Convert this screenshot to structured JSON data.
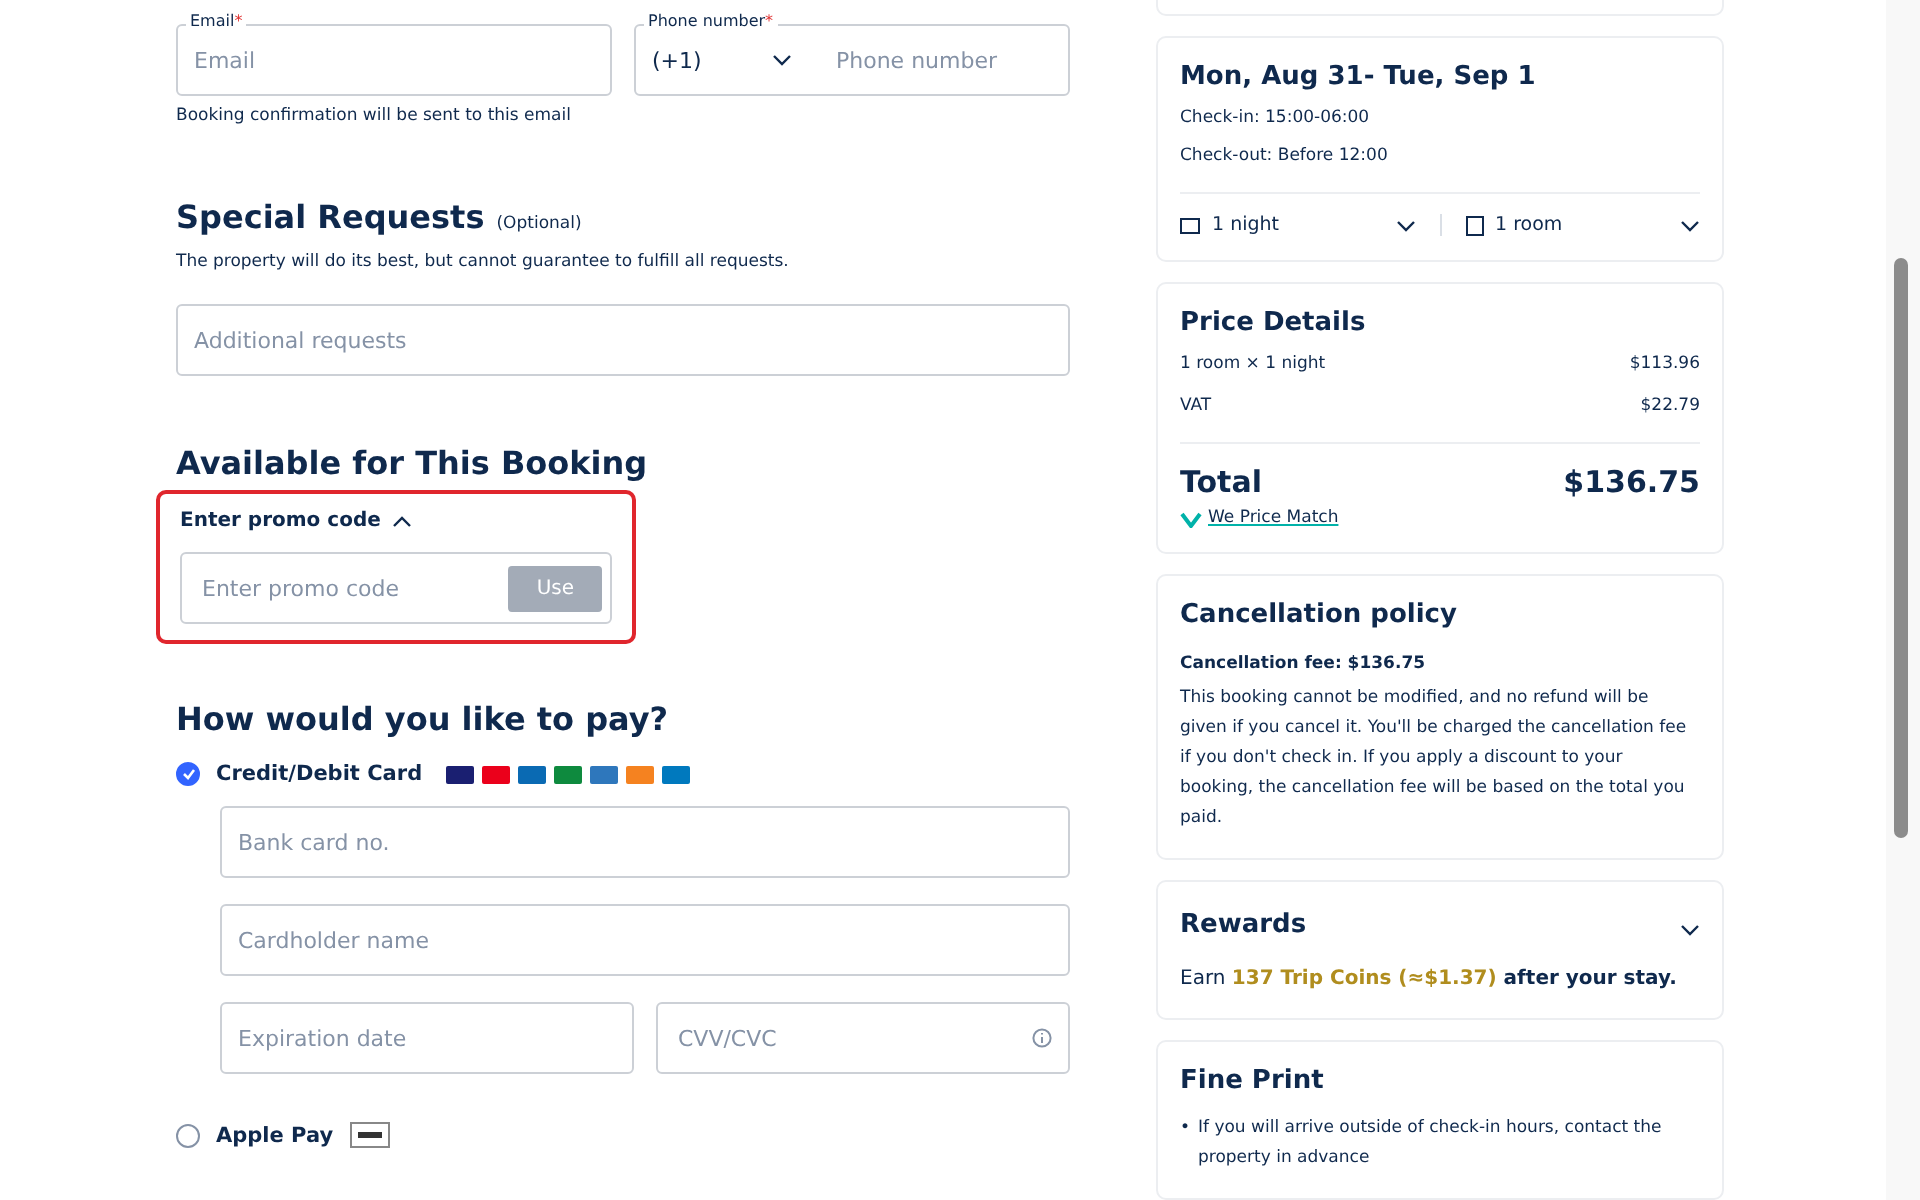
{
  "contact": {
    "email": {
      "label": "Email",
      "required_mark": "*",
      "placeholder": "Email",
      "hint": "Booking confirmation will be sent to this email"
    },
    "phone": {
      "label": "Phone number",
      "required_mark": "*",
      "code": "(+1)",
      "placeholder": "Phone number"
    }
  },
  "special_requests": {
    "title": "Special Requests",
    "optional": "(Optional)",
    "note": "The property will do its best, but cannot guarantee to fulfill all requests.",
    "placeholder": "Additional requests"
  },
  "promo": {
    "title": "Available for This Booking",
    "toggle": "Enter promo code",
    "expanded": true,
    "placeholder": "Enter promo code",
    "button": "Use",
    "button_disabled": true
  },
  "payment": {
    "title": "How would you like to pay?",
    "options": [
      {
        "kind": "card",
        "label": "Credit/Debit Card",
        "selected": true
      },
      {
        "kind": "applepay",
        "label": "Apple Pay",
        "selected": false
      }
    ],
    "fields": {
      "card_number": {
        "placeholder": "Bank card no."
      },
      "holder": {
        "placeholder": "Cardholder name"
      },
      "expiry": {
        "placeholder": "Expiration date"
      },
      "cvv": {
        "placeholder": "CVV/CVC"
      }
    }
  },
  "stay": {
    "dates": "Mon, Aug 31- Tue, Sep 1",
    "check_in": "Check-in: 15:00-06:00",
    "check_out": "Check-out: Before 12:00",
    "nights": "1 night",
    "rooms": "1 room"
  },
  "price": {
    "title": "Price Details",
    "rows": [
      {
        "label": "1 room × 1 night",
        "value": "$113.96"
      },
      {
        "label": "VAT",
        "value": "$22.79"
      }
    ],
    "total_label": "Total",
    "total": "$136.75",
    "price_match": "We Price Match"
  },
  "cancellation": {
    "title": "Cancellation policy",
    "fee": "Cancellation fee: $136.75",
    "text": "This booking cannot be modified, and no refund will be given if you cancel it. You'll be charged the cancellation fee if you don't check in. If you apply a discount to your booking, the cancellation fee will be based on the total you paid."
  },
  "rewards": {
    "title": "Rewards",
    "before": "Earn ",
    "highlight": "137 Trip Coins (≈$1.37)",
    "after": " after your stay.",
    "expanded": false
  },
  "fine_print": {
    "title": "Fine Print",
    "bullet": "•",
    "items": [
      "If you will arrive outside of check-in hours, contact the property in advance"
    ]
  }
}
